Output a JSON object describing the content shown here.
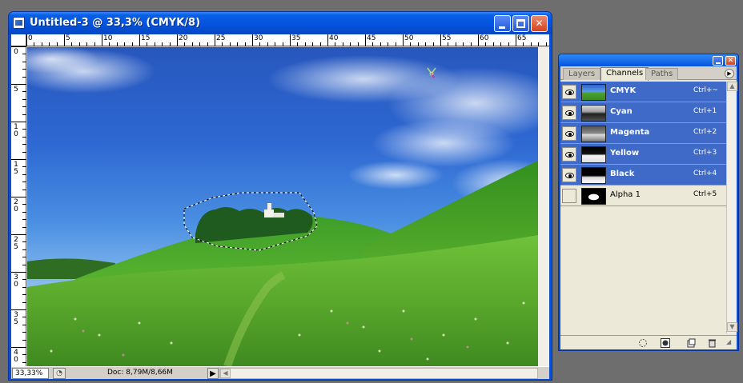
{
  "document": {
    "title": "Untitled-3 @ 33,3% (CMYK/8)",
    "zoom": "33,33%",
    "doc_info": "Doc: 8,79M/8,66M",
    "ruler_h_labels": [
      "0",
      "5",
      "10",
      "15",
      "20",
      "25",
      "30",
      "35",
      "40",
      "45",
      "50",
      "55",
      "60",
      "65"
    ],
    "ruler_v_labels": [
      "0",
      "5",
      "10",
      "15",
      "20",
      "25",
      "30",
      "35",
      "40"
    ]
  },
  "palette": {
    "tabs": [
      "Layers",
      "Channels",
      "Paths"
    ],
    "active_tab": "Channels",
    "channels": [
      {
        "name": "CMYK",
        "shortcut": "Ctrl+~",
        "visible": true,
        "selected": true
      },
      {
        "name": "Cyan",
        "shortcut": "Ctrl+1",
        "visible": true,
        "selected": true
      },
      {
        "name": "Magenta",
        "shortcut": "Ctrl+2",
        "visible": true,
        "selected": true
      },
      {
        "name": "Yellow",
        "shortcut": "Ctrl+3",
        "visible": true,
        "selected": true
      },
      {
        "name": "Black",
        "shortcut": "Ctrl+4",
        "visible": true,
        "selected": true
      },
      {
        "name": "Alpha 1",
        "shortcut": "Ctrl+5",
        "visible": false,
        "selected": false
      }
    ]
  },
  "colors": {
    "title_blue": "#0553de",
    "selection_blue": "#3f6ac8",
    "close_red": "#d1441f",
    "panel_bg": "#ece9d8"
  }
}
